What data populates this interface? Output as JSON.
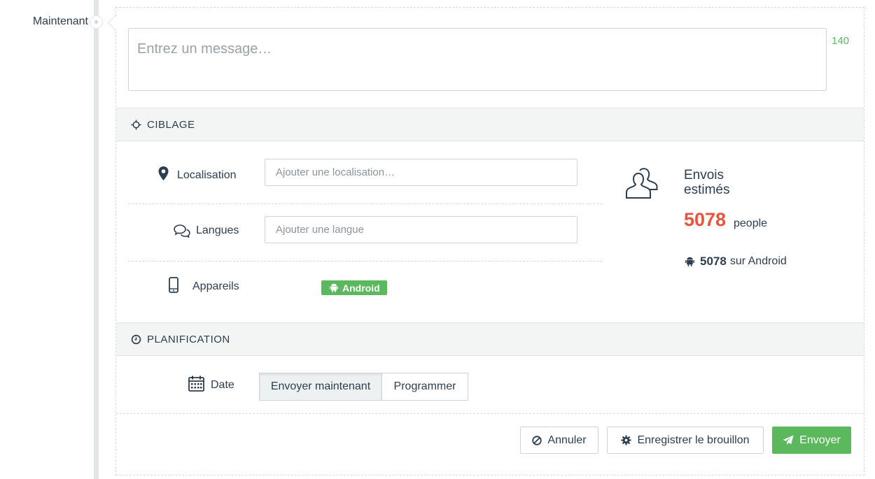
{
  "timeline": {
    "label": "Maintenant"
  },
  "composer": {
    "placeholder": "Entrez un message…",
    "char_count": "140"
  },
  "targeting": {
    "header": "CIBLAGE",
    "location": {
      "label": "Localisation",
      "placeholder": "Ajouter une localisation…"
    },
    "languages": {
      "label": "Langues",
      "placeholder": "Ajouter une langue"
    },
    "devices": {
      "label": "Appareils",
      "badge": "Android"
    }
  },
  "estimate": {
    "title": "Envois estimés",
    "count": "5078",
    "unit": "people",
    "android_count": "5078",
    "android_label": "sur Android"
  },
  "planning": {
    "header": "PLANIFICATION",
    "date_label": "Date",
    "options": [
      "Envoyer maintenant",
      "Programmer"
    ],
    "selected": "Envoyer maintenant"
  },
  "actions": {
    "cancel": "Annuler",
    "save_draft": "Enregistrer le brouillon",
    "send": "Envoyer"
  },
  "colors": {
    "accent_green": "#5cb85c",
    "count_orange": "#e8553a",
    "text": "#2c3e50"
  }
}
